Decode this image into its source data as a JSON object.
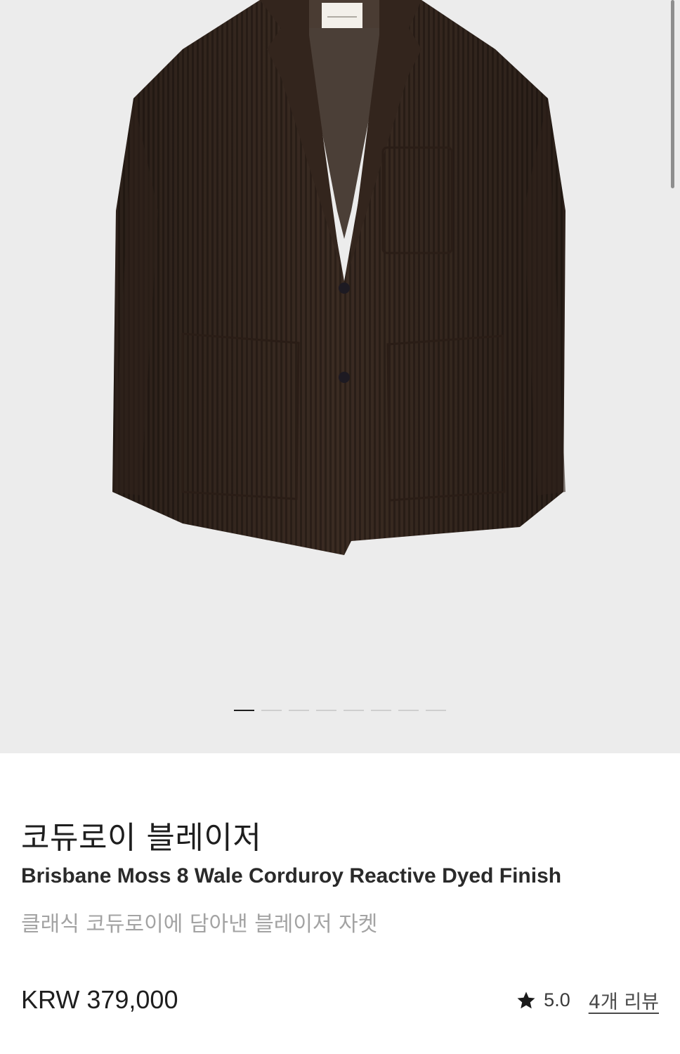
{
  "gallery": {
    "image_alt": "코듀로이 블레이저 product photo",
    "slide_count": 8,
    "active_slide": 0,
    "colors": {
      "background": "#ececec",
      "jacket": "#3a2b22",
      "dot_active": "#1f1f1f",
      "dot_inactive": "#cfcfcf"
    }
  },
  "product": {
    "title_ko": "코듀로이 블레이저",
    "title_en": "Brisbane Moss 8 Wale Corduroy Reactive Dyed Finish",
    "subtitle": "클래식 코듀로이에 담아낸 블레이저 자켓",
    "price": "KRW 379,000",
    "rating": "5.0",
    "rating_icon": "star-icon",
    "review_link": "4개 리뷰"
  }
}
